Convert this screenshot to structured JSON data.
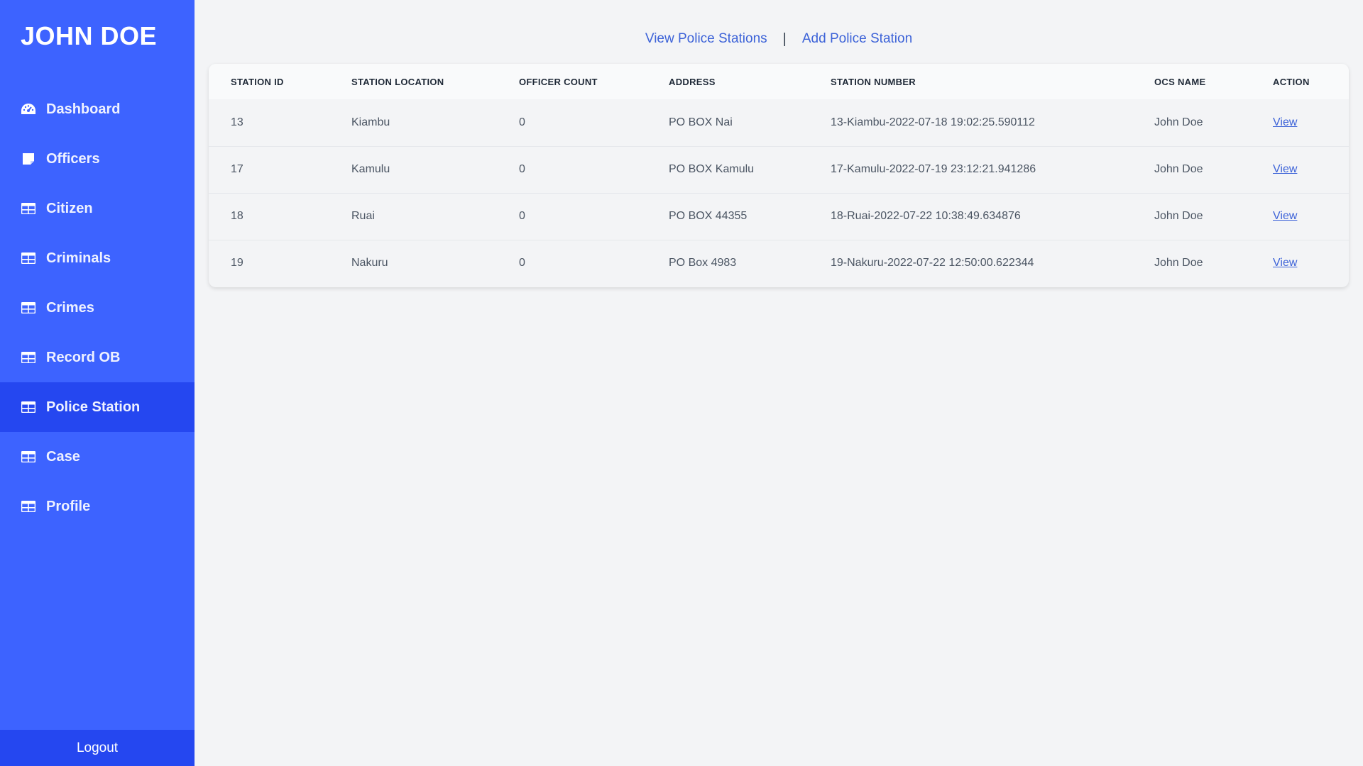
{
  "sidebar": {
    "brand": "JOHN DOE",
    "items": [
      {
        "label": "Dashboard",
        "icon": "dashboard-icon"
      },
      {
        "label": "Officers",
        "icon": "note-icon"
      },
      {
        "label": "Citizen",
        "icon": "table-icon"
      },
      {
        "label": "Criminals",
        "icon": "table-icon"
      },
      {
        "label": "Crimes",
        "icon": "table-icon"
      },
      {
        "label": "Record OB",
        "icon": "table-icon"
      },
      {
        "label": "Police Station",
        "icon": "table-icon",
        "active": true
      },
      {
        "label": "Case",
        "icon": "table-icon"
      },
      {
        "label": "Profile",
        "icon": "table-icon"
      }
    ],
    "logout": "Logout"
  },
  "topnav": {
    "view_link": "View Police Stations",
    "separator": "|",
    "add_link": "Add Police Station"
  },
  "table": {
    "headers": [
      "STATION ID",
      "STATION LOCATION",
      "OFFICER COUNT",
      "ADDRESS",
      "STATION NUMBER",
      "OCS NAME",
      "ACTION"
    ],
    "rows": [
      {
        "id": "13",
        "location": "Kiambu",
        "officers": "0",
        "address": "PO BOX Nai",
        "number": "13-Kiambu-2022-07-18 19:02:25.590112",
        "ocs": "John Doe",
        "action": "View"
      },
      {
        "id": "17",
        "location": "Kamulu",
        "officers": "0",
        "address": "PO BOX Kamulu",
        "number": "17-Kamulu-2022-07-19 23:12:21.941286",
        "ocs": "John Doe",
        "action": "View"
      },
      {
        "id": "18",
        "location": "Ruai",
        "officers": "0",
        "address": "PO BOX 44355",
        "number": "18-Ruai-2022-07-22 10:38:49.634876",
        "ocs": "John Doe",
        "action": "View"
      },
      {
        "id": "19",
        "location": "Nakuru",
        "officers": "0",
        "address": "PO Box 4983",
        "number": "19-Nakuru-2022-07-22 12:50:00.622344",
        "ocs": "John Doe",
        "action": "View"
      }
    ]
  },
  "colors": {
    "sidebar": "#3d63ff",
    "sidebar_active": "#2547f0",
    "link": "#3d63d8",
    "background": "#f3f4f6"
  }
}
